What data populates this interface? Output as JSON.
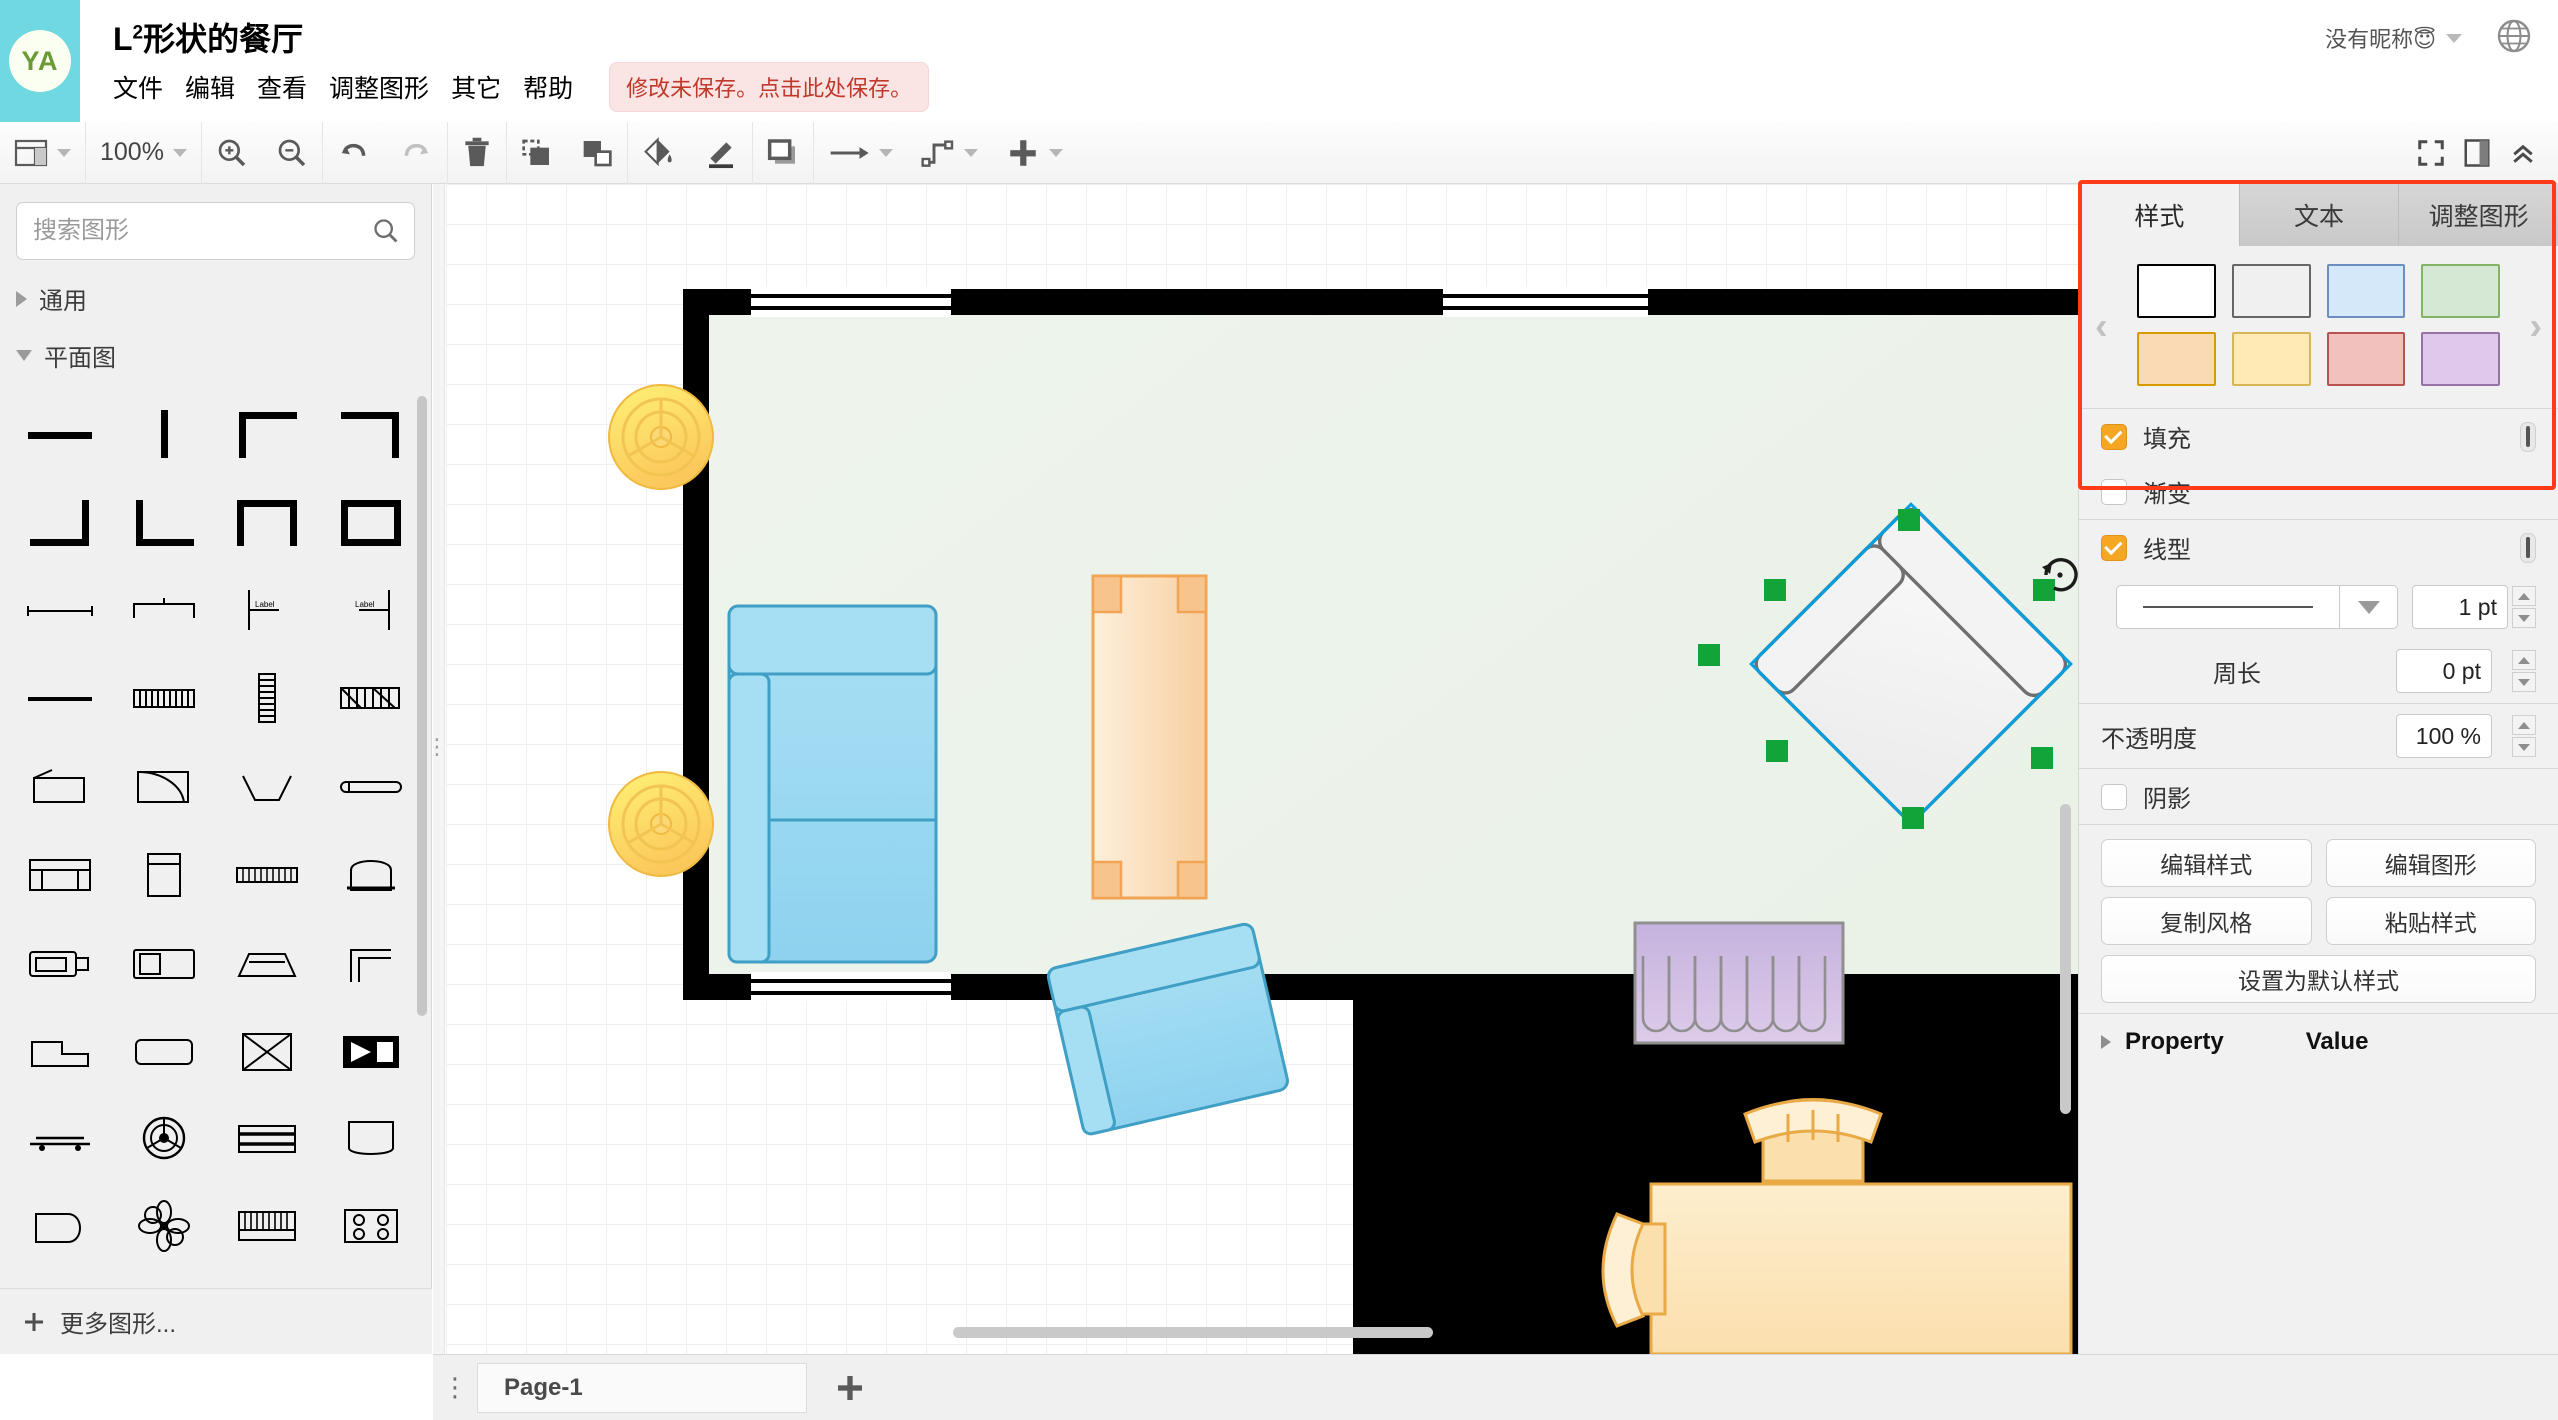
{
  "header": {
    "avatar_initials": "YA",
    "doc_title_main": "L",
    "doc_title_sup": "2",
    "doc_title_rest": "形状的餐厅",
    "menus": [
      "文件",
      "编辑",
      "查看",
      "调整图形",
      "其它",
      "帮助"
    ],
    "save_banner": "修改未保存。点击此处保存。",
    "account_name": "没有昵称😇",
    "globe_icon": "globe-icon"
  },
  "toolbar": {
    "view_icon": "layout-panel-icon",
    "zoom_level": "100%",
    "items": [
      {
        "name": "zoom-in-icon"
      },
      {
        "name": "zoom-out-icon"
      },
      {
        "name": "undo-icon"
      },
      {
        "name": "redo-icon"
      },
      {
        "name": "delete-icon"
      },
      {
        "name": "bring-to-front-icon"
      },
      {
        "name": "send-to-back-icon"
      },
      {
        "name": "fill-color-icon"
      },
      {
        "name": "line-color-icon"
      },
      {
        "name": "shadow-icon"
      },
      {
        "name": "arrow-style-icon"
      },
      {
        "name": "waypoints-icon"
      },
      {
        "name": "insert-icon"
      }
    ],
    "right_items": [
      "fullscreen-icon",
      "format-panel-icon",
      "collapse-icon"
    ]
  },
  "sidebar": {
    "search_placeholder": "搜索图形",
    "search_value": "",
    "sections": [
      {
        "label": "通用",
        "expanded": false
      },
      {
        "label": "平面图",
        "expanded": true
      }
    ],
    "more_shapes": "更多图形..."
  },
  "right_panel": {
    "tabs": [
      {
        "label": "样式",
        "active": true
      },
      {
        "label": "文本",
        "active": false
      },
      {
        "label": "调整图形",
        "active": false
      }
    ],
    "swatches": [
      {
        "fill": "#ffffff",
        "stroke": "#000000"
      },
      {
        "fill": "#f0f0f0",
        "stroke": "#666666"
      },
      {
        "fill": "#d5e8f9",
        "stroke": "#6c8ebf"
      },
      {
        "fill": "#d5e8d4",
        "stroke": "#82b366"
      },
      {
        "fill": "#fad9b5",
        "stroke": "#d79b00"
      },
      {
        "fill": "#ffe9b5",
        "stroke": "#d6b656"
      },
      {
        "fill": "#f2c0bd",
        "stroke": "#b85450"
      },
      {
        "fill": "#dfc8ea",
        "stroke": "#9673a6"
      }
    ],
    "prev_arrow": "chevron-left-icon",
    "next_arrow": "chevron-right-icon",
    "fill": {
      "label": "填充",
      "checked": true,
      "color": "#ffffff"
    },
    "gradient": {
      "label": "渐变",
      "checked": false
    },
    "line": {
      "label": "线型",
      "checked": true,
      "color": "#5f5f5f",
      "style": "solid",
      "width": "1 pt"
    },
    "perimeter": {
      "label": "周长",
      "value": "0 pt"
    },
    "opacity": {
      "label": "不透明度",
      "value": "100 %"
    },
    "shadow": {
      "label": "阴影",
      "checked": false
    },
    "buttons": [
      "编辑样式",
      "编辑图形",
      "复制风格",
      "粘贴样式",
      "设置为默认样式"
    ],
    "property_header": "Property",
    "value_header": "Value"
  },
  "bottom": {
    "page_menu_icon": "page-menu-icon",
    "page_tab": "Page-1",
    "add_page_icon": "add-page-icon"
  },
  "canvas": {
    "selected_shape": "rotated-sofa",
    "rotate_handle_icon": "rotate-icon",
    "handle_color": "#12A339",
    "selection_outline_color": "#00A0E0",
    "room_fill": "#edf3ea",
    "wall_color": "#000000",
    "furniture": [
      {
        "name": "ceiling-lamp-top",
        "color": "#ffd966"
      },
      {
        "name": "ceiling-lamp-bottom",
        "color": "#ffd966"
      },
      {
        "name": "blue-sofa-large",
        "color": "#9ad9f0"
      },
      {
        "name": "orange-table",
        "color": "#fbd9a8"
      },
      {
        "name": "blue-armchair",
        "color": "#9ad9f0"
      },
      {
        "name": "purple-curtain",
        "color": "#d5c3e6"
      },
      {
        "name": "dining-table-chairs",
        "color": "#fce7c0"
      }
    ]
  }
}
